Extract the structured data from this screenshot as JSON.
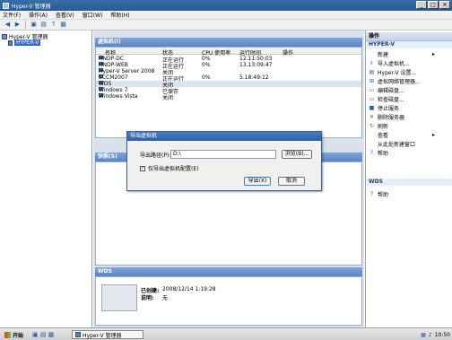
{
  "window": {
    "title": "Hyper-V 管理器",
    "buttons": [
      "_",
      "□",
      "✕"
    ]
  },
  "menu": [
    "文件(F)",
    "操作(A)",
    "查看(V)",
    "窗口(W)",
    "帮助(H)"
  ],
  "tree": {
    "root": "Hyper-V 管理器",
    "server": "HYPER-V"
  },
  "vms": {
    "title": "虚拟机(I)",
    "columns": [
      "名称",
      "状态",
      "CPU 使用率",
      "运行时间",
      "操作"
    ],
    "rows": [
      {
        "name": "HNDP-DC",
        "state": "正在运行",
        "cpu": "0%",
        "uptime": "12.11:50:03"
      },
      {
        "name": "HNDP-WEB",
        "state": "正在运行",
        "cpu": "0%",
        "uptime": "13.13:09:47"
      },
      {
        "name": "Hyper-V Server 2008",
        "state": "关闭",
        "cpu": "",
        "uptime": ""
      },
      {
        "name": "SCCM2007",
        "state": "正在运行",
        "cpu": "0%",
        "uptime": "5.18:49:12"
      },
      {
        "name": "WDS",
        "state": "关闭",
        "cpu": "",
        "uptime": ""
      },
      {
        "name": "Windows 7",
        "state": "已保存",
        "cpu": "",
        "uptime": ""
      },
      {
        "name": "Windows Vista",
        "state": "关闭",
        "cpu": "",
        "uptime": ""
      }
    ]
  },
  "snapshots": {
    "title": "快照(S)"
  },
  "details": {
    "title": "WDS",
    "created_label": "已创建:",
    "created_value": "2008/12/14 1:19:28",
    "notes_label": "说明:",
    "notes_value": "无"
  },
  "actions": {
    "title": "操作",
    "section1": "HYPER-V",
    "items1": [
      "新建",
      "导入虚拟机...",
      "Hyper-V 设置...",
      "虚拟网络管理器...",
      "编辑磁盘...",
      "检查磁盘...",
      "停止服务",
      "删除服务器",
      "刷新",
      "查看",
      "从此处新建窗口",
      "帮助"
    ],
    "section2": "WDS",
    "items2": [
      "帮助"
    ]
  },
  "dialog": {
    "title": "导出虚拟机",
    "path_label": "导出路径(P):",
    "path_value": "D:\\",
    "browse_button": "浏览(B)...",
    "checkbox_label": "仅导出虚拟机配置(E)",
    "checkbox_checked": true,
    "export_button": "导出(X)",
    "cancel_button": "取消"
  },
  "taskbar": {
    "start": "开始",
    "task": "Hyper-V 管理器",
    "clock": "10:50"
  }
}
